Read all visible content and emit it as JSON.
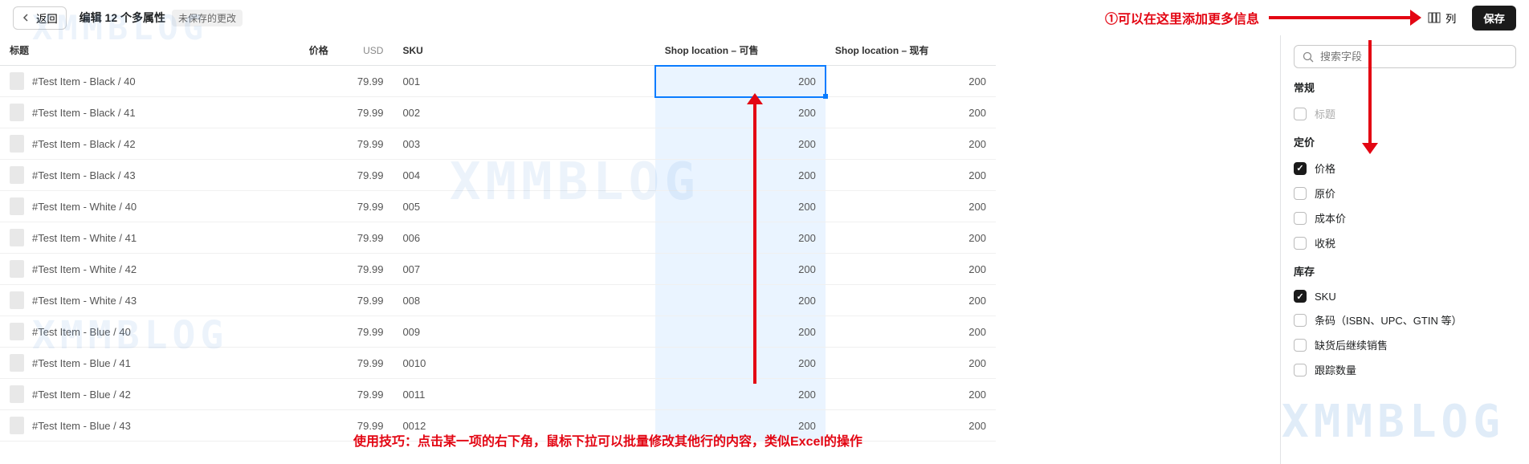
{
  "header": {
    "back_label": "返回",
    "title": "编辑 12 个多属性",
    "unsaved_label": "未保存的更改",
    "columns_label": "列",
    "save_label": "保存"
  },
  "annotations": {
    "top_text": "①可以在这里添加更多信息",
    "tip_text": "使用技巧：点击某一项的右下角，鼠标下拉可以批量修改其他行的内容，类似Excel的操作"
  },
  "table": {
    "headers": {
      "title": "标题",
      "price": "价格",
      "currency": "USD",
      "sku": "SKU",
      "loc_available": "Shop location – 可售",
      "loc_onhand": "Shop location – 现有"
    },
    "rows": [
      {
        "title": "#Test Item - Black / 40",
        "price": "79.99",
        "sku": "001",
        "avail": "200",
        "onhand": "200"
      },
      {
        "title": "#Test Item - Black / 41",
        "price": "79.99",
        "sku": "002",
        "avail": "200",
        "onhand": "200"
      },
      {
        "title": "#Test Item - Black / 42",
        "price": "79.99",
        "sku": "003",
        "avail": "200",
        "onhand": "200"
      },
      {
        "title": "#Test Item - Black / 43",
        "price": "79.99",
        "sku": "004",
        "avail": "200",
        "onhand": "200"
      },
      {
        "title": "#Test Item - White / 40",
        "price": "79.99",
        "sku": "005",
        "avail": "200",
        "onhand": "200"
      },
      {
        "title": "#Test Item - White / 41",
        "price": "79.99",
        "sku": "006",
        "avail": "200",
        "onhand": "200"
      },
      {
        "title": "#Test Item - White / 42",
        "price": "79.99",
        "sku": "007",
        "avail": "200",
        "onhand": "200"
      },
      {
        "title": "#Test Item - White / 43",
        "price": "79.99",
        "sku": "008",
        "avail": "200",
        "onhand": "200"
      },
      {
        "title": "#Test Item - Blue / 40",
        "price": "79.99",
        "sku": "009",
        "avail": "200",
        "onhand": "200"
      },
      {
        "title": "#Test Item - Blue / 41",
        "price": "79.99",
        "sku": "0010",
        "avail": "200",
        "onhand": "200"
      },
      {
        "title": "#Test Item - Blue / 42",
        "price": "79.99",
        "sku": "0011",
        "avail": "200",
        "onhand": "200"
      },
      {
        "title": "#Test Item - Blue / 43",
        "price": "79.99",
        "sku": "0012",
        "avail": "200",
        "onhand": "200"
      }
    ]
  },
  "panel": {
    "search_placeholder": "搜索字段",
    "sections": {
      "general": "常规",
      "pricing": "定价",
      "inventory": "库存"
    },
    "fields": {
      "title": "标题",
      "price": "价格",
      "compare_at": "原价",
      "cost": "成本价",
      "tax": "收税",
      "sku": "SKU",
      "barcode": "条码（ISBN、UPC、GTIN 等）",
      "continue_selling": "缺货后继续销售",
      "track_qty": "跟踪数量"
    }
  },
  "watermark": "XMMBLOG"
}
